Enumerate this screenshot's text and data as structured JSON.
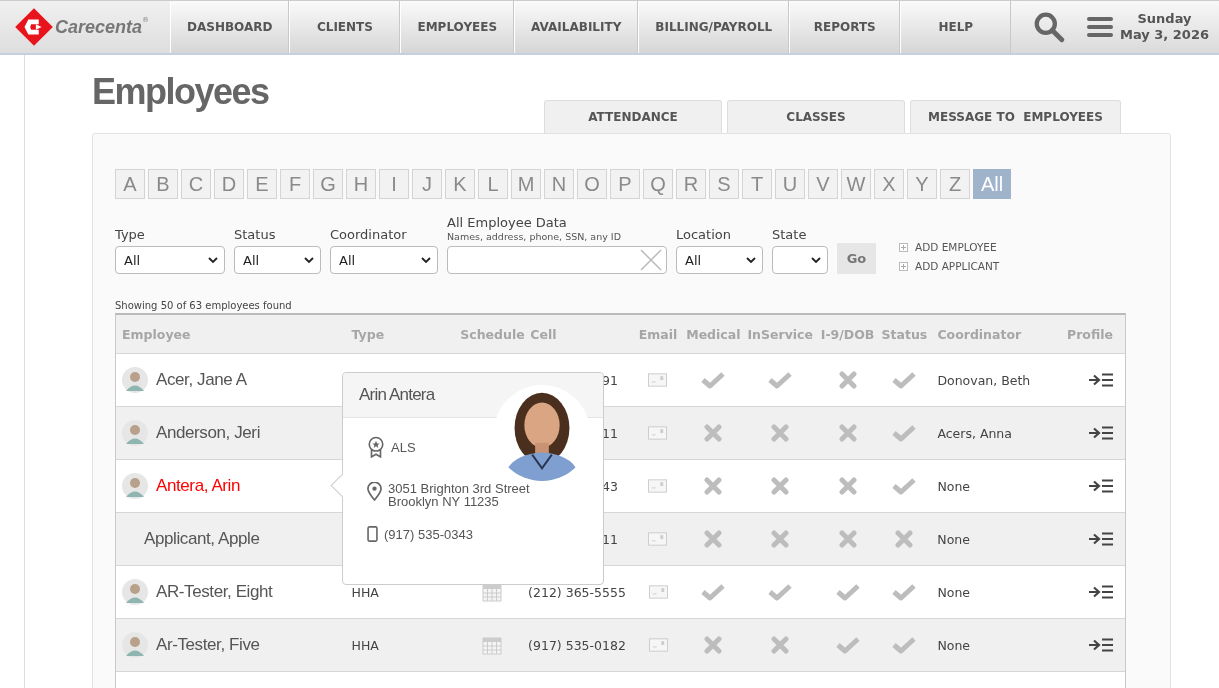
{
  "header": {
    "logo": "Carecenta",
    "logo_mark": "®",
    "nav": [
      "DASHBOARD",
      "CLIENTS",
      "EMPLOYEES",
      "AVAILABILITY",
      "BILLING/PAYROLL",
      "REPORTS",
      "HELP"
    ],
    "day": "Sunday",
    "date": "May 3, 2026"
  },
  "title": "Employees",
  "tabs": [
    "ATTENDANCE",
    "CLASSES",
    "MESSAGE TO  EMPLOYEES"
  ],
  "letters": [
    {
      "label": "A",
      "selected": false
    },
    {
      "label": "B",
      "selected": false
    },
    {
      "label": "C",
      "selected": false
    },
    {
      "label": "D",
      "selected": false
    },
    {
      "label": "E",
      "selected": false
    },
    {
      "label": "F",
      "selected": false
    },
    {
      "label": "G",
      "selected": false
    },
    {
      "label": "H",
      "selected": false
    },
    {
      "label": "I",
      "selected": false
    },
    {
      "label": "J",
      "selected": false
    },
    {
      "label": "K",
      "selected": false
    },
    {
      "label": "L",
      "selected": false
    },
    {
      "label": "M",
      "selected": false
    },
    {
      "label": "N",
      "selected": false
    },
    {
      "label": "O",
      "selected": false
    },
    {
      "label": "P",
      "selected": false
    },
    {
      "label": "Q",
      "selected": false
    },
    {
      "label": "R",
      "selected": false
    },
    {
      "label": "S",
      "selected": false
    },
    {
      "label": "T",
      "selected": false
    },
    {
      "label": "U",
      "selected": false
    },
    {
      "label": "V",
      "selected": false
    },
    {
      "label": "W",
      "selected": false
    },
    {
      "label": "X",
      "selected": false
    },
    {
      "label": "Y",
      "selected": false
    },
    {
      "label": "Z",
      "selected": false
    },
    {
      "label": "All",
      "selected": true
    }
  ],
  "filters": [
    {
      "kind": "select",
      "label": "Type",
      "value": "All"
    },
    {
      "kind": "select",
      "label": "Status",
      "value": "All"
    },
    {
      "kind": "select",
      "label": "Coordinator",
      "value": "All"
    },
    {
      "kind": "search",
      "label": "All Employee Data",
      "hint": "Names, address, phone, SSN, any ID"
    },
    {
      "kind": "select",
      "label": "Location",
      "value": "All"
    },
    {
      "kind": "select",
      "label": "State"
    }
  ],
  "go_button": "Go",
  "actions": [
    "ADD EMPLOYEE",
    "ADD APPLICANT"
  ],
  "summary": "Showing 50 of 63 employees found",
  "table": {
    "columns": [
      "Employee",
      "Type",
      "Schedule",
      "Cell",
      "Email",
      "Medical",
      "InService",
      "I-9/DOB",
      "Status",
      "Coordinator",
      "Profile"
    ],
    "rows": [
      {
        "name": "Acer, Jane A",
        "selected": false,
        "avatar": true,
        "schedule": false,
        "cell": "91",
        "medical": true,
        "inservice": true,
        "i9": false,
        "status": true,
        "coordinator": "Donovan, Beth"
      },
      {
        "name": "Anderson, Jeri",
        "selected": false,
        "avatar": true,
        "schedule": false,
        "cell": "11",
        "medical": false,
        "inservice": false,
        "i9": false,
        "status": true,
        "coordinator": "Acers, Anna"
      },
      {
        "name": "Antera, Arin",
        "selected": true,
        "avatar": true,
        "schedule": false,
        "cell": "43",
        "medical": false,
        "inservice": false,
        "i9": false,
        "status": true,
        "coordinator": "None"
      },
      {
        "name": "Applicant, Apple",
        "selected": false,
        "avatar": false,
        "schedule": false,
        "cell": "11",
        "medical": false,
        "inservice": false,
        "i9": false,
        "status": false,
        "coordinator": "None"
      },
      {
        "name": "AR-Tester, Eight",
        "selected": false,
        "avatar": true,
        "type": "HHA",
        "schedule": true,
        "cell": "(212) 365-5555",
        "medical": true,
        "inservice": true,
        "i9": true,
        "status": true,
        "coordinator": "None"
      },
      {
        "name": "Ar-Tester, Five",
        "selected": false,
        "avatar": true,
        "type": "HHA",
        "schedule": true,
        "cell": "(917) 535-0182",
        "medical": false,
        "inservice": false,
        "i9": true,
        "status": true,
        "coordinator": "None"
      }
    ]
  },
  "popup": {
    "name": "Arin Antera",
    "certification": "ALS",
    "address_lines": [
      "3051 Brighton 3rd Street",
      "Brooklyn NY 11235"
    ],
    "phone": "(917) 535-0343"
  }
}
